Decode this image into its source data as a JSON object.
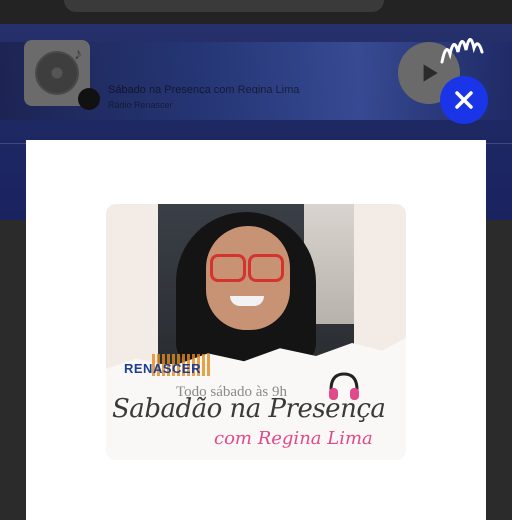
{
  "player": {
    "episode_title": "Sábado na Presença com Regina Lima",
    "episode_subtitle": "Rádio Renascer"
  },
  "modal": {
    "poster": {
      "brand": "RENASCER",
      "schedule": "Todo sábado às 9h",
      "show_title": "Sabadão na Presença",
      "host": "com Regina Lima"
    }
  },
  "icons": {
    "close": "close-icon",
    "brand": "podcast-wave-icon",
    "play": "play-icon",
    "headphones": "headphones-icon"
  },
  "colors": {
    "close_button": "#1a35e8",
    "brand_text": "#1e3f93",
    "host_text": "#e04a8a",
    "glasses": "#d4332e"
  }
}
